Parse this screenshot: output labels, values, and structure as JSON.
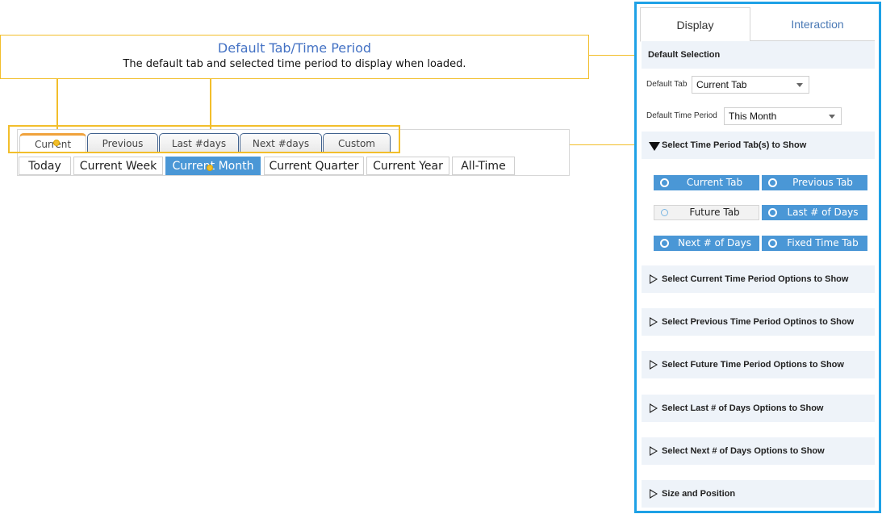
{
  "callout": {
    "title": "Default Tab/Time Period",
    "description": "The default tab and selected time period to display when loaded."
  },
  "widget": {
    "tabs": [
      "Current",
      "Previous",
      "Last #days",
      "Next #days",
      "Custom"
    ],
    "active_tab": "Current",
    "periods": [
      "Today",
      "Current Week",
      "Current Month",
      "Current Quarter",
      "Current Year",
      "All-Time"
    ],
    "selected_period": "Current Month"
  },
  "panel": {
    "tabs": {
      "display": "Display",
      "interaction": "Interaction"
    },
    "default_selection": {
      "header": "Default Selection",
      "default_tab_label": "Default Tab",
      "default_tab_value": "Current Tab",
      "default_period_label": "Default Time Period",
      "default_period_value": "This Month"
    },
    "tab_section": {
      "header": "Select Time Period Tab(s) to Show",
      "buttons": [
        {
          "label": "Current Tab",
          "selected": true
        },
        {
          "label": "Previous Tab",
          "selected": true
        },
        {
          "label": "Future Tab",
          "selected": false
        },
        {
          "label": "Last # of Days Tab",
          "selected": true
        },
        {
          "label": "Next # of Days Tab",
          "selected": true
        },
        {
          "label": "Fixed Time Tab",
          "selected": true
        }
      ]
    },
    "sections": [
      "Select Current Time Period Options to Show",
      "Select Previous Time Period Optinos to Show",
      "Select Future Time Period Options to Show",
      "Select Last # of Days Options to Show",
      "Select Next # of Days Options to Show",
      "Size and Position"
    ]
  },
  "colors": {
    "accent_blue": "#4a97d6",
    "panel_border": "#1ea1e6",
    "callout_yellow": "#f2be2b",
    "active_tab_orange": "#f0a23c"
  }
}
